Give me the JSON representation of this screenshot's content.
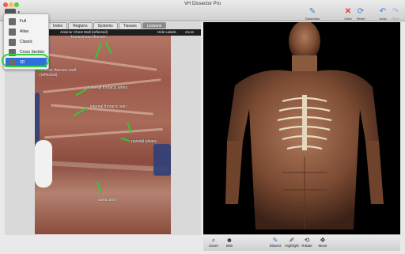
{
  "window": {
    "title": "VH Dissector Pro"
  },
  "toolbar": {
    "view_menu_icon": "view-icon",
    "dissection_label": "Dissection",
    "clear_label": "Clear",
    "reset_label": "Reset",
    "undo_label": "Undo",
    "redo_label": "Redo"
  },
  "view_menu": {
    "items": [
      {
        "label": "Full",
        "icon": "full-view-icon"
      },
      {
        "label": "Atlas",
        "icon": "atlas-view-icon"
      },
      {
        "label": "Classic",
        "icon": "classic-view-icon"
      },
      {
        "label": "Cross Section",
        "icon": "cross-section-view-icon"
      },
      {
        "label": "3D",
        "icon": "3d-view-icon",
        "selected": true
      }
    ]
  },
  "tabs": [
    "Index",
    "Regions",
    "Systems",
    "Tissues",
    "Lessons"
  ],
  "active_tab": "Lessons",
  "image_panel": {
    "caption": "Anterior Chest Wall (reflected)",
    "hide_labels": "Hide Labels",
    "zoom": "Zoom",
    "labels": [
      "transversus thoracic",
      "anterior thoracic wall (reflected)",
      "internal thoracic artery",
      "internal thoracic vein",
      "parietal pleura",
      "aortic arch"
    ]
  },
  "bottom_toolbar": {
    "items": [
      {
        "label": "Zoom",
        "icon": "magnifier-icon"
      },
      {
        "label": "Skin",
        "icon": "person-icon"
      },
      {
        "label": "Dissect",
        "icon": "scalpel-icon"
      },
      {
        "label": "Highlight",
        "icon": "highlighter-icon"
      },
      {
        "label": "Rotate",
        "icon": "rotate-icon"
      },
      {
        "label": "Move",
        "icon": "move-icon"
      }
    ]
  },
  "colors": {
    "accent": "#2f6fdb",
    "arrow_green": "#37c53a",
    "clear_red": "#e0383e",
    "reset_blue": "#3a7fd6"
  }
}
